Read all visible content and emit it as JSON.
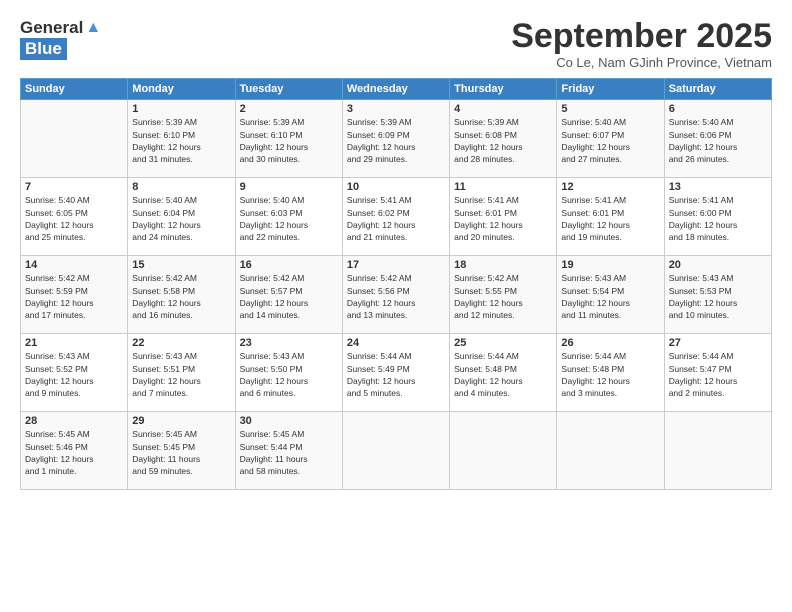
{
  "header": {
    "logo_general": "General",
    "logo_blue": "Blue",
    "month_title": "September 2025",
    "subtitle": "Co Le, Nam GJinh Province, Vietnam"
  },
  "days_of_week": [
    "Sunday",
    "Monday",
    "Tuesday",
    "Wednesday",
    "Thursday",
    "Friday",
    "Saturday"
  ],
  "weeks": [
    [
      {
        "day": "",
        "info": ""
      },
      {
        "day": "1",
        "info": "Sunrise: 5:39 AM\nSunset: 6:10 PM\nDaylight: 12 hours\nand 31 minutes."
      },
      {
        "day": "2",
        "info": "Sunrise: 5:39 AM\nSunset: 6:10 PM\nDaylight: 12 hours\nand 30 minutes."
      },
      {
        "day": "3",
        "info": "Sunrise: 5:39 AM\nSunset: 6:09 PM\nDaylight: 12 hours\nand 29 minutes."
      },
      {
        "day": "4",
        "info": "Sunrise: 5:39 AM\nSunset: 6:08 PM\nDaylight: 12 hours\nand 28 minutes."
      },
      {
        "day": "5",
        "info": "Sunrise: 5:40 AM\nSunset: 6:07 PM\nDaylight: 12 hours\nand 27 minutes."
      },
      {
        "day": "6",
        "info": "Sunrise: 5:40 AM\nSunset: 6:06 PM\nDaylight: 12 hours\nand 26 minutes."
      }
    ],
    [
      {
        "day": "7",
        "info": "Sunrise: 5:40 AM\nSunset: 6:05 PM\nDaylight: 12 hours\nand 25 minutes."
      },
      {
        "day": "8",
        "info": "Sunrise: 5:40 AM\nSunset: 6:04 PM\nDaylight: 12 hours\nand 24 minutes."
      },
      {
        "day": "9",
        "info": "Sunrise: 5:40 AM\nSunset: 6:03 PM\nDaylight: 12 hours\nand 22 minutes."
      },
      {
        "day": "10",
        "info": "Sunrise: 5:41 AM\nSunset: 6:02 PM\nDaylight: 12 hours\nand 21 minutes."
      },
      {
        "day": "11",
        "info": "Sunrise: 5:41 AM\nSunset: 6:01 PM\nDaylight: 12 hours\nand 20 minutes."
      },
      {
        "day": "12",
        "info": "Sunrise: 5:41 AM\nSunset: 6:01 PM\nDaylight: 12 hours\nand 19 minutes."
      },
      {
        "day": "13",
        "info": "Sunrise: 5:41 AM\nSunset: 6:00 PM\nDaylight: 12 hours\nand 18 minutes."
      }
    ],
    [
      {
        "day": "14",
        "info": "Sunrise: 5:42 AM\nSunset: 5:59 PM\nDaylight: 12 hours\nand 17 minutes."
      },
      {
        "day": "15",
        "info": "Sunrise: 5:42 AM\nSunset: 5:58 PM\nDaylight: 12 hours\nand 16 minutes."
      },
      {
        "day": "16",
        "info": "Sunrise: 5:42 AM\nSunset: 5:57 PM\nDaylight: 12 hours\nand 14 minutes."
      },
      {
        "day": "17",
        "info": "Sunrise: 5:42 AM\nSunset: 5:56 PM\nDaylight: 12 hours\nand 13 minutes."
      },
      {
        "day": "18",
        "info": "Sunrise: 5:42 AM\nSunset: 5:55 PM\nDaylight: 12 hours\nand 12 minutes."
      },
      {
        "day": "19",
        "info": "Sunrise: 5:43 AM\nSunset: 5:54 PM\nDaylight: 12 hours\nand 11 minutes."
      },
      {
        "day": "20",
        "info": "Sunrise: 5:43 AM\nSunset: 5:53 PM\nDaylight: 12 hours\nand 10 minutes."
      }
    ],
    [
      {
        "day": "21",
        "info": "Sunrise: 5:43 AM\nSunset: 5:52 PM\nDaylight: 12 hours\nand 9 minutes."
      },
      {
        "day": "22",
        "info": "Sunrise: 5:43 AM\nSunset: 5:51 PM\nDaylight: 12 hours\nand 7 minutes."
      },
      {
        "day": "23",
        "info": "Sunrise: 5:43 AM\nSunset: 5:50 PM\nDaylight: 12 hours\nand 6 minutes."
      },
      {
        "day": "24",
        "info": "Sunrise: 5:44 AM\nSunset: 5:49 PM\nDaylight: 12 hours\nand 5 minutes."
      },
      {
        "day": "25",
        "info": "Sunrise: 5:44 AM\nSunset: 5:48 PM\nDaylight: 12 hours\nand 4 minutes."
      },
      {
        "day": "26",
        "info": "Sunrise: 5:44 AM\nSunset: 5:48 PM\nDaylight: 12 hours\nand 3 minutes."
      },
      {
        "day": "27",
        "info": "Sunrise: 5:44 AM\nSunset: 5:47 PM\nDaylight: 12 hours\nand 2 minutes."
      }
    ],
    [
      {
        "day": "28",
        "info": "Sunrise: 5:45 AM\nSunset: 5:46 PM\nDaylight: 12 hours\nand 1 minute."
      },
      {
        "day": "29",
        "info": "Sunrise: 5:45 AM\nSunset: 5:45 PM\nDaylight: 11 hours\nand 59 minutes."
      },
      {
        "day": "30",
        "info": "Sunrise: 5:45 AM\nSunset: 5:44 PM\nDaylight: 11 hours\nand 58 minutes."
      },
      {
        "day": "",
        "info": ""
      },
      {
        "day": "",
        "info": ""
      },
      {
        "day": "",
        "info": ""
      },
      {
        "day": "",
        "info": ""
      }
    ]
  ]
}
